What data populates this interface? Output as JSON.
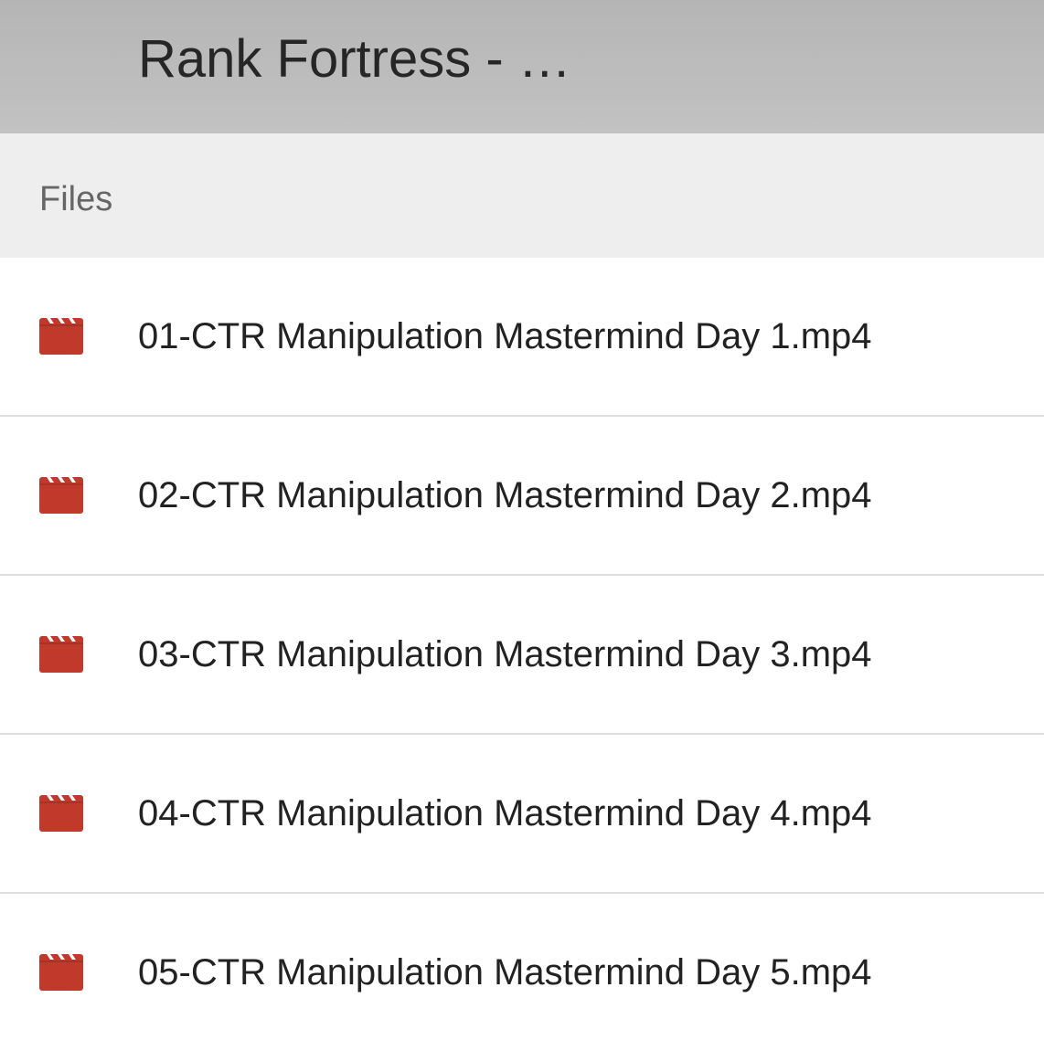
{
  "header": {
    "title": "Rank Fortress - …"
  },
  "subheader": {
    "label": "Files"
  },
  "files": [
    {
      "name": "01-CTR Manipulation Mastermind Day 1.mp4",
      "icon": "video-file-icon"
    },
    {
      "name": "02-CTR Manipulation Mastermind Day 2.mp4",
      "icon": "video-file-icon"
    },
    {
      "name": "03-CTR Manipulation Mastermind Day 3.mp4",
      "icon": "video-file-icon"
    },
    {
      "name": "04-CTR Manipulation Mastermind Day 4.mp4",
      "icon": "video-file-icon"
    },
    {
      "name": "05-CTR Manipulation Mastermind Day 5.mp4",
      "icon": "video-file-icon"
    }
  ],
  "colors": {
    "icon_red": "#c0392b",
    "header_gray": "#bdbdbd",
    "subheader_gray": "#eeeeee"
  }
}
